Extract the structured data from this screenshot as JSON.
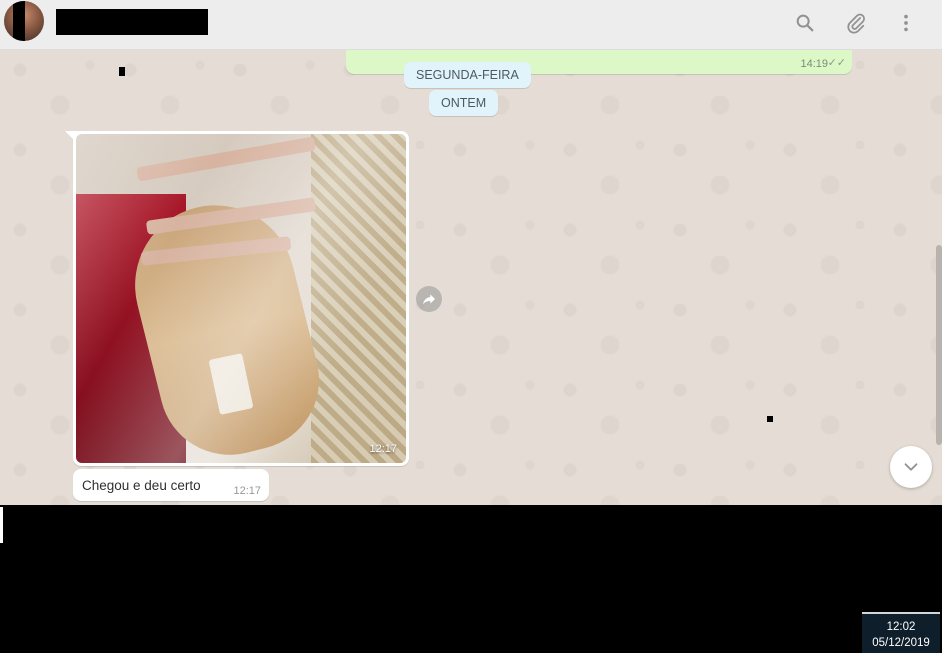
{
  "header": {
    "contact_name": "",
    "icons": [
      "search-icon",
      "paperclip-icon",
      "more-vertical-icon"
    ]
  },
  "messages": {
    "outgoing": {
      "time": "14:19",
      "status": "read"
    },
    "date_chips": [
      "SEGUNDA-FEIRA",
      "ONTEM"
    ],
    "image_message": {
      "time": "12:17"
    },
    "text_message": {
      "text": "Chegou e deu certo",
      "time": "12:17"
    }
  },
  "taskbar": {
    "time": "12:02",
    "date": "05/12/2019"
  },
  "colors": {
    "header_bg": "#ededed",
    "chat_bg": "#e5ddd5",
    "outgoing_bubble": "#dcf8c6",
    "date_chip_bg": "#e1f3fb",
    "icon_gray": "#919191"
  }
}
